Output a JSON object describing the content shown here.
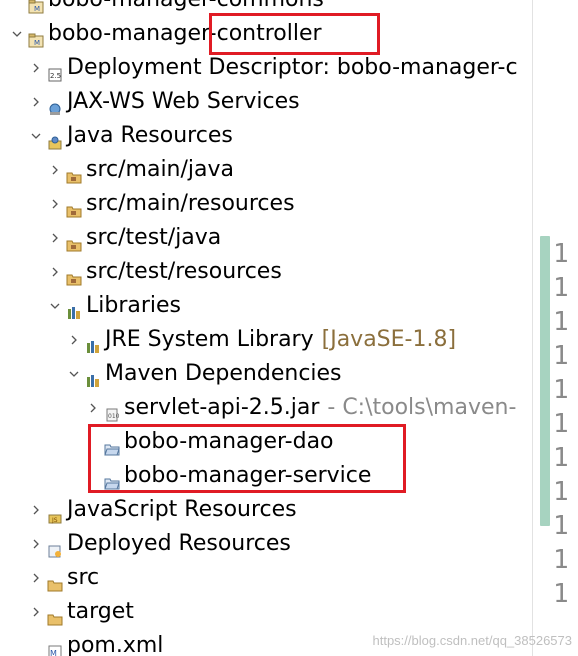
{
  "tree": {
    "rows": [
      {
        "label": "bobo-manager-commons",
        "deco": "",
        "decoStyle": "",
        "icon": "project",
        "twisty": "none"
      },
      {
        "label": "bobo-manager-controller",
        "deco": "",
        "decoStyle": "",
        "icon": "project",
        "twisty": "down"
      },
      {
        "label": "Deployment Descriptor: bobo-manager-c",
        "deco": "",
        "decoStyle": "",
        "icon": "descriptor",
        "twisty": "right"
      },
      {
        "label": "JAX-WS Web Services",
        "deco": "",
        "decoStyle": "",
        "icon": "webservices",
        "twisty": "right"
      },
      {
        "label": "Java Resources",
        "deco": "",
        "decoStyle": "",
        "icon": "javares",
        "twisty": "down"
      },
      {
        "label": "src/main/java",
        "deco": "",
        "decoStyle": "",
        "icon": "srcfolder",
        "twisty": "right"
      },
      {
        "label": "src/main/resources",
        "deco": "",
        "decoStyle": "",
        "icon": "srcfolder",
        "twisty": "right"
      },
      {
        "label": "src/test/java",
        "deco": "",
        "decoStyle": "",
        "icon": "srcfolder",
        "twisty": "right"
      },
      {
        "label": "src/test/resources",
        "deco": "",
        "decoStyle": "",
        "icon": "srcfolder",
        "twisty": "right"
      },
      {
        "label": "Libraries",
        "deco": "",
        "decoStyle": "",
        "icon": "library",
        "twisty": "down"
      },
      {
        "label": "JRE System Library",
        "deco": "[JavaSE-1.8]",
        "decoStyle": "brown",
        "icon": "library",
        "twisty": "right"
      },
      {
        "label": "Maven Dependencies",
        "deco": "",
        "decoStyle": "",
        "icon": "library",
        "twisty": "down"
      },
      {
        "label": "servlet-api-2.5.jar",
        "deco": "- C:\\tools\\maven-",
        "decoStyle": "gray",
        "icon": "jar",
        "twisty": "right"
      },
      {
        "label": "bobo-manager-dao",
        "deco": "",
        "decoStyle": "",
        "icon": "openfolder",
        "twisty": "none"
      },
      {
        "label": "bobo-manager-service",
        "deco": "",
        "decoStyle": "",
        "icon": "openfolder",
        "twisty": "none"
      },
      {
        "label": "JavaScript Resources",
        "deco": "",
        "decoStyle": "",
        "icon": "jsres",
        "twisty": "right"
      },
      {
        "label": "Deployed Resources",
        "deco": "",
        "decoStyle": "",
        "icon": "deployed",
        "twisty": "right"
      },
      {
        "label": "src",
        "deco": "",
        "decoStyle": "",
        "icon": "folder",
        "twisty": "right"
      },
      {
        "label": "target",
        "deco": "",
        "decoStyle": "",
        "icon": "folder",
        "twisty": "right"
      },
      {
        "label": "pom.xml",
        "deco": "",
        "decoStyle": "",
        "icon": "pom",
        "twisty": "none"
      }
    ]
  },
  "gutter": [
    "1",
    "1",
    "1",
    "1",
    "1",
    "1",
    "1",
    "1",
    "1",
    "1",
    "1"
  ],
  "watermark": "https://blog.csdn.net/qq_38526573",
  "colors": {
    "highlight": "#e01b24",
    "scroll_thumb": "#a7d3c0",
    "decoration_brown": "#8b6f3c",
    "decoration_gray": "#8a8a8a"
  }
}
